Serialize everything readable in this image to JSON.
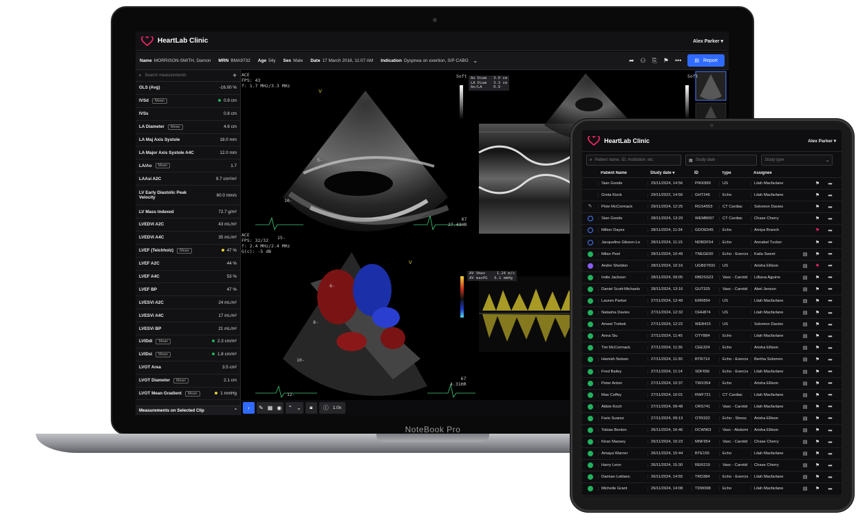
{
  "laptop": {
    "brand_label": "NoteBook Pro",
    "app_title": "HeartLab Clinic",
    "user": "Alex Parker",
    "patient": {
      "name_label": "Name",
      "name": "MORRISON-SMITH, Damon",
      "mrn_label": "MRN",
      "mrn": "BMA9732",
      "age_label": "Age",
      "age": "54y",
      "sex_label": "Sex",
      "sex": "Male",
      "date_label": "Date",
      "date": "17 March 2016, 11:07 AM",
      "indication_label": "Indication",
      "indication": "Dyspnea on exertion, S/P CABG"
    },
    "report_button": "Report",
    "search_placeholder": "Search measurements",
    "measurements": [
      {
        "label": "GLS (Avg)",
        "value": "-16.00 %",
        "mean": false,
        "dot": ""
      },
      {
        "label": "IVSd",
        "value": "0.9 cm",
        "mean": true,
        "dot": "#21b25d"
      },
      {
        "label": "IVSs",
        "value": "0.8 cm",
        "mean": false,
        "dot": ""
      },
      {
        "label": "LA Diameter",
        "value": "4.6 cm",
        "mean": true,
        "dot": ""
      },
      {
        "label": "LA Maj Axis Systole",
        "value": "18.0 mm",
        "mean": false,
        "dot": ""
      },
      {
        "label": "LA Major Axis Systole A4C",
        "value": "12.0 mm",
        "mean": false,
        "dot": ""
      },
      {
        "label": "LA/Ao",
        "value": "1.7",
        "mean": true,
        "dot": ""
      },
      {
        "label": "LAAsi A2C",
        "value": "9.7 cm²/m²",
        "mean": false,
        "dot": ""
      },
      {
        "label": "LV Early Diastolic Peak Velocity",
        "value": "60.0 mm/s",
        "mean": false,
        "dot": "",
        "tall": true
      },
      {
        "label": "LV Mass Indexed",
        "value": "72.7 g/m²",
        "mean": false,
        "dot": ""
      },
      {
        "label": "LVEDVi A2C",
        "value": "43 mL/m²",
        "mean": false,
        "dot": ""
      },
      {
        "label": "LVEDVi A4C",
        "value": "35 mL/m²",
        "mean": false,
        "dot": ""
      },
      {
        "label": "LVEF (Teichholz)",
        "value": "47 %",
        "mean": true,
        "dot": "#e6d23a"
      },
      {
        "label": "LVEF A2C",
        "value": "44 %",
        "mean": false,
        "dot": ""
      },
      {
        "label": "LVEF A4C",
        "value": "53 %",
        "mean": false,
        "dot": ""
      },
      {
        "label": "LVEF BP",
        "value": "47 %",
        "mean": false,
        "dot": ""
      },
      {
        "label": "LVESVi A2C",
        "value": "24 mL/m²",
        "mean": false,
        "dot": ""
      },
      {
        "label": "LVESVi A4C",
        "value": "17 mL/m²",
        "mean": false,
        "dot": ""
      },
      {
        "label": "LVESVi BP",
        "value": "21 mL/m²",
        "mean": false,
        "dot": ""
      },
      {
        "label": "LVIDdi",
        "value": "2.3 cm/m²",
        "mean": true,
        "dot": "#21b25d"
      },
      {
        "label": "LVIDsi",
        "value": "1.8 cm/m²",
        "mean": true,
        "dot": "#21b25d"
      },
      {
        "label": "LVOT Area",
        "value": "3.5 cm²",
        "mean": false,
        "dot": ""
      },
      {
        "label": "LVOT Diameter",
        "value": "2.1 cm",
        "mean": true,
        "dot": ""
      },
      {
        "label": "LVOT Mean Gradient",
        "value": "1 mmHg",
        "mean": true,
        "dot": "#e6d23a"
      }
    ],
    "mean_tag": "Mean",
    "side_footer": "Measurements on Selected Clip",
    "zoom": "1.0x",
    "clips": {
      "c1": "ACE\nFPS: 43\nf: 1.7 MHz/3.3 MHz",
      "c2": "ACE\nFPS: 32/32\nf: 2.4 MHz/2.4 MHz\nG(c): -5 dB",
      "soft": "Soft",
      "hr1": "67\n27.43HR",
      "hr2": "67\n4.31HR",
      "ao": "Ao Diam   3.0 cm\nLA Diam   3.3 cm\nAo/LA     0.9",
      "av": "AV Vmax     1.24 m/s\nAV maxPG   6.1 mmHg",
      "depth": [
        "5-",
        "10-",
        "15-"
      ],
      "depth2": [
        "6-",
        "8-",
        "10-",
        "12-"
      ]
    }
  },
  "tablet": {
    "app_title": "HeartLab Clinic",
    "user": "Alex Parker",
    "search_placeholder": "Patient name, ID, institution, etc.",
    "date_placeholder": "Study date",
    "type_placeholder": "Study type",
    "columns": {
      "name": "Patient Name",
      "date": "Study date",
      "id": "ID",
      "type": "Type",
      "assignee": "Assignee"
    },
    "rows": [
      {
        "s": "none",
        "name": "Sian Goode",
        "date": "29/11/2024, 14:56",
        "id": "PIKK899",
        "type": "US",
        "asg": "Lilah Macfarlane",
        "doc": false,
        "flag": "#ddd"
      },
      {
        "s": "none",
        "name": "Greta Kizck",
        "date": "29/11/2022, 14:56",
        "id": "GHT246",
        "type": "Echo",
        "asg": "Lilah Macfarlane",
        "doc": false,
        "flag": "#ddd"
      },
      {
        "s": "pen",
        "name": "Pixie McCormack",
        "date": "29/11/2024, 12:25",
        "id": "RGS4553",
        "type": "CT Cardiac",
        "asg": "Solomon Davies",
        "doc": false,
        "flag": "#ddd"
      },
      {
        "s": "ring",
        "name": "Sian Goode",
        "date": "28/11/2024, 13:29",
        "id": "WEMB097",
        "type": "CT Cardiac",
        "asg": "Chase Cherry",
        "doc": false,
        "flag": "#ddd"
      },
      {
        "s": "ring",
        "name": "Milton Dayes",
        "date": "28/11/2024, 11:34",
        "id": "GDOE545",
        "type": "Echo",
        "asg": "Amiya Branch",
        "doc": false,
        "flag": "#e8245f"
      },
      {
        "s": "ring",
        "name": "Jacqueline Gibson-Lo",
        "date": "28/11/2024, 11:15",
        "id": "NDBDF54",
        "type": "Echo",
        "asg": "Annabel Tucker",
        "doc": false,
        "flag": "#ddd"
      },
      {
        "s": "ok",
        "name": "Milan Peel",
        "date": "28/11/2024, 10:49",
        "id": "TNEGE00",
        "type": "Echo - Exercis",
        "asg": "Kaila Sweet",
        "doc": true,
        "flag": "#ddd"
      },
      {
        "s": "pur",
        "name": "Andre Sheldon",
        "date": "28/11/2024, 10:16",
        "id": "UGBD7691",
        "type": "US",
        "asg": "Arisha Ellison",
        "doc": true,
        "flag": "#e8245f"
      },
      {
        "s": "ok",
        "name": "Indie Jackson",
        "date": "28/11/2024, 09:05",
        "id": "RBDSS23",
        "type": "Vasc - Carotid",
        "asg": "Lilliana Aguirre",
        "doc": true,
        "flag": "#ddd"
      },
      {
        "s": "ok",
        "name": "Daniel Scott-Michaels",
        "date": "28/11/2024, 13:16",
        "id": "GUT325",
        "type": "Vasc - Carotid",
        "asg": "Abel Jenson",
        "doc": true,
        "flag": "#ddd"
      },
      {
        "s": "ok",
        "name": "Lauren Parker",
        "date": "27/11/2024, 12:49",
        "id": "ERR854",
        "type": "US",
        "asg": "Lilah Macfarlane",
        "doc": true,
        "flag": "#ddd"
      },
      {
        "s": "ok",
        "name": "Natasha Davies",
        "date": "27/11/2024, 12:32",
        "id": "OHH874",
        "type": "US",
        "asg": "Lilah Macfarlane",
        "doc": true,
        "flag": "#ddd"
      },
      {
        "s": "ok",
        "name": "Ameel Trebek",
        "date": "27/11/2024, 12:22",
        "id": "WEB415",
        "type": "US",
        "asg": "Solomon Davies",
        "doc": true,
        "flag": "#ddd"
      },
      {
        "s": "ok",
        "name": "Anna Siu",
        "date": "27/11/2024, 11:45",
        "id": "OTY884",
        "type": "Echo",
        "asg": "Lilah Macfarlane",
        "doc": true,
        "flag": "#ddd"
      },
      {
        "s": "ok",
        "name": "Tim McCormack",
        "date": "27/11/2024, 11:36",
        "id": "CEE324",
        "type": "Echo",
        "asg": "Arisha Ellison",
        "doc": true,
        "flag": "#ddd"
      },
      {
        "s": "ok",
        "name": "Hamish Nelson",
        "date": "27/11/2024, 11:30",
        "id": "BTR714",
        "type": "Echo - Exercis",
        "asg": "Bertha Solomon",
        "doc": true,
        "flag": "#ddd"
      },
      {
        "s": "ok",
        "name": "Fred Bailey",
        "date": "27/11/2024, 11:14",
        "id": "SDF656",
        "type": "Echo - Exercis",
        "asg": "Lilah Macfarlane",
        "doc": true,
        "flag": "#ddd"
      },
      {
        "s": "ok",
        "name": "Peter Anton",
        "date": "27/11/2024, 10:37",
        "id": "TWX354",
        "type": "Echo",
        "asg": "Arisha Ellison",
        "doc": true,
        "flag": "#ddd"
      },
      {
        "s": "ok",
        "name": "Max Coffey",
        "date": "27/11/2024, 10:01",
        "id": "RWF721",
        "type": "CT Cardiac",
        "asg": "Lilah Macfarlane",
        "doc": true,
        "flag": "#ddd"
      },
      {
        "s": "ok",
        "name": "Abbie Koch",
        "date": "27/11/2024, 09:48",
        "id": "ORS741",
        "type": "Vasc - Carotid",
        "asg": "Lilah Macfarlane",
        "doc": true,
        "flag": "#ddd"
      },
      {
        "s": "ok",
        "name": "Faris Suarez",
        "date": "27/11/2024, 09:13",
        "id": "OTR322",
        "type": "Echo - Stress",
        "asg": "Arisha Ellison",
        "doc": true,
        "flag": "#ddd"
      },
      {
        "s": "ok",
        "name": "Tobias Benton",
        "date": "26/11/2024, 16:46",
        "id": "DCW963",
        "type": "Vasc - Abdomi",
        "asg": "Arisha Ellison",
        "doc": true,
        "flag": "#ddd"
      },
      {
        "s": "ok",
        "name": "Kiran Massey",
        "date": "26/11/2024, 16:23",
        "id": "MNF954",
        "type": "Vasc - Carotid",
        "asg": "Chase Cherry",
        "doc": true,
        "flag": "#ddd"
      },
      {
        "s": "ok",
        "name": "Amaya Warner",
        "date": "26/11/2024, 15:44",
        "id": "BTE155",
        "type": "Echo",
        "asg": "Lilah Macfarlane",
        "doc": true,
        "flag": "#ddd"
      },
      {
        "s": "ok",
        "name": "Harry Leon",
        "date": "26/11/2024, 15:30",
        "id": "RER219",
        "type": "Vasc - Carotid",
        "asg": "Chase Cherry",
        "doc": true,
        "flag": "#ddd"
      },
      {
        "s": "ok",
        "name": "Damian Leblanc",
        "date": "26/11/2024, 14:55",
        "id": "TRD384",
        "type": "Echo - Exercis",
        "asg": "Lilah Macfarlane",
        "doc": true,
        "flag": "#ddd"
      },
      {
        "s": "ok",
        "name": "Michelle Grant",
        "date": "26/11/2024, 14:08",
        "id": "TDW098",
        "type": "Echo",
        "asg": "Lilah Macfarlane",
        "doc": true,
        "flag": "#ddd"
      }
    ]
  },
  "colors": {
    "accent": "#2f6bff",
    "ok": "#21b25d",
    "flag_red": "#e8245f",
    "brand": "#e8245f"
  }
}
